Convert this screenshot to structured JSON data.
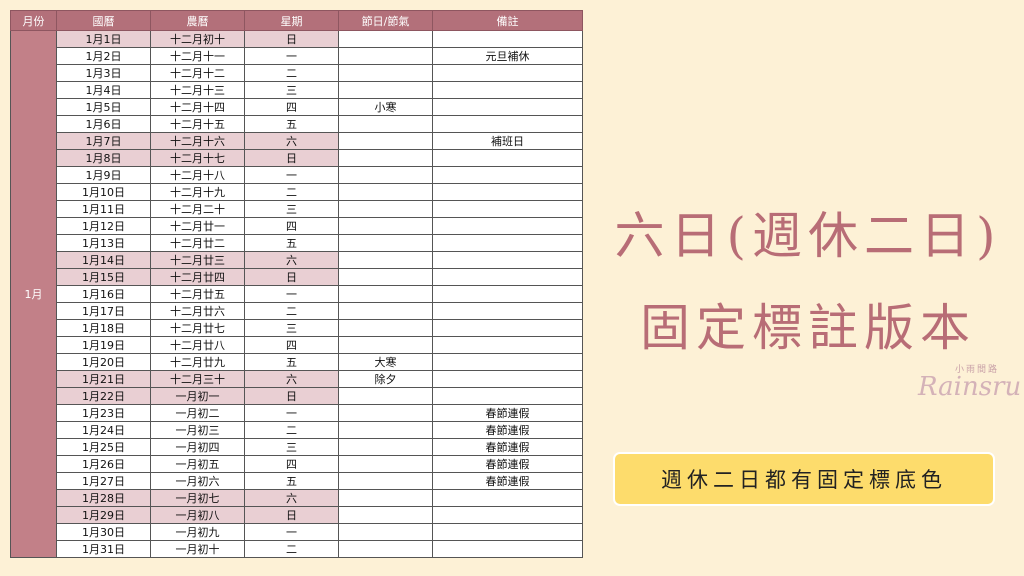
{
  "headers": [
    "月份",
    "國曆",
    "農曆",
    "星期",
    "節日/節氣",
    "備註"
  ],
  "month_label": "1月",
  "rows": [
    {
      "date": "1月1日",
      "lunar": "十二月初十",
      "weekday": "日",
      "festival": "",
      "note": "",
      "weekend": true
    },
    {
      "date": "1月2日",
      "lunar": "十二月十一",
      "weekday": "一",
      "festival": "",
      "note": "元旦補休",
      "weekend": false
    },
    {
      "date": "1月3日",
      "lunar": "十二月十二",
      "weekday": "二",
      "festival": "",
      "note": "",
      "weekend": false
    },
    {
      "date": "1月4日",
      "lunar": "十二月十三",
      "weekday": "三",
      "festival": "",
      "note": "",
      "weekend": false
    },
    {
      "date": "1月5日",
      "lunar": "十二月十四",
      "weekday": "四",
      "festival": "小寒",
      "note": "",
      "weekend": false
    },
    {
      "date": "1月6日",
      "lunar": "十二月十五",
      "weekday": "五",
      "festival": "",
      "note": "",
      "weekend": false
    },
    {
      "date": "1月7日",
      "lunar": "十二月十六",
      "weekday": "六",
      "festival": "",
      "note": "補班日",
      "weekend": true
    },
    {
      "date": "1月8日",
      "lunar": "十二月十七",
      "weekday": "日",
      "festival": "",
      "note": "",
      "weekend": true
    },
    {
      "date": "1月9日",
      "lunar": "十二月十八",
      "weekday": "一",
      "festival": "",
      "note": "",
      "weekend": false
    },
    {
      "date": "1月10日",
      "lunar": "十二月十九",
      "weekday": "二",
      "festival": "",
      "note": "",
      "weekend": false
    },
    {
      "date": "1月11日",
      "lunar": "十二月二十",
      "weekday": "三",
      "festival": "",
      "note": "",
      "weekend": false
    },
    {
      "date": "1月12日",
      "lunar": "十二月廿一",
      "weekday": "四",
      "festival": "",
      "note": "",
      "weekend": false
    },
    {
      "date": "1月13日",
      "lunar": "十二月廿二",
      "weekday": "五",
      "festival": "",
      "note": "",
      "weekend": false
    },
    {
      "date": "1月14日",
      "lunar": "十二月廿三",
      "weekday": "六",
      "festival": "",
      "note": "",
      "weekend": true
    },
    {
      "date": "1月15日",
      "lunar": "十二月廿四",
      "weekday": "日",
      "festival": "",
      "note": "",
      "weekend": true
    },
    {
      "date": "1月16日",
      "lunar": "十二月廿五",
      "weekday": "一",
      "festival": "",
      "note": "",
      "weekend": false
    },
    {
      "date": "1月17日",
      "lunar": "十二月廿六",
      "weekday": "二",
      "festival": "",
      "note": "",
      "weekend": false
    },
    {
      "date": "1月18日",
      "lunar": "十二月廿七",
      "weekday": "三",
      "festival": "",
      "note": "",
      "weekend": false
    },
    {
      "date": "1月19日",
      "lunar": "十二月廿八",
      "weekday": "四",
      "festival": "",
      "note": "",
      "weekend": false
    },
    {
      "date": "1月20日",
      "lunar": "十二月廿九",
      "weekday": "五",
      "festival": "大寒",
      "note": "",
      "weekend": false
    },
    {
      "date": "1月21日",
      "lunar": "十二月三十",
      "weekday": "六",
      "festival": "除夕",
      "note": "",
      "weekend": true
    },
    {
      "date": "1月22日",
      "lunar": "一月初一",
      "weekday": "日",
      "festival": "",
      "note": "",
      "weekend": true
    },
    {
      "date": "1月23日",
      "lunar": "一月初二",
      "weekday": "一",
      "festival": "",
      "note": "春節連假",
      "weekend": false
    },
    {
      "date": "1月24日",
      "lunar": "一月初三",
      "weekday": "二",
      "festival": "",
      "note": "春節連假",
      "weekend": false
    },
    {
      "date": "1月25日",
      "lunar": "一月初四",
      "weekday": "三",
      "festival": "",
      "note": "春節連假",
      "weekend": false
    },
    {
      "date": "1月26日",
      "lunar": "一月初五",
      "weekday": "四",
      "festival": "",
      "note": "春節連假",
      "weekend": false
    },
    {
      "date": "1月27日",
      "lunar": "一月初六",
      "weekday": "五",
      "festival": "",
      "note": "春節連假",
      "weekend": false
    },
    {
      "date": "1月28日",
      "lunar": "一月初七",
      "weekday": "六",
      "festival": "",
      "note": "",
      "weekend": true
    },
    {
      "date": "1月29日",
      "lunar": "一月初八",
      "weekday": "日",
      "festival": "",
      "note": "",
      "weekend": true
    },
    {
      "date": "1月30日",
      "lunar": "一月初九",
      "weekday": "一",
      "festival": "",
      "note": "",
      "weekend": false
    },
    {
      "date": "1月31日",
      "lunar": "一月初十",
      "weekday": "二",
      "festival": "",
      "note": "",
      "weekend": false
    }
  ],
  "title_line1": "六日(週休二日)",
  "title_line2": "固定標註版本",
  "logo_small": "小雨間路",
  "logo": "Rainsru",
  "banner": "週休二日都有固定標底色",
  "colors": {
    "header_bg": "#b3707a",
    "weekend_bg": "#e9cfd3",
    "month_bg": "#c28088",
    "page_bg": "#fdf1d6",
    "title": "#b86d76",
    "banner_bg": "#fddc6c"
  }
}
